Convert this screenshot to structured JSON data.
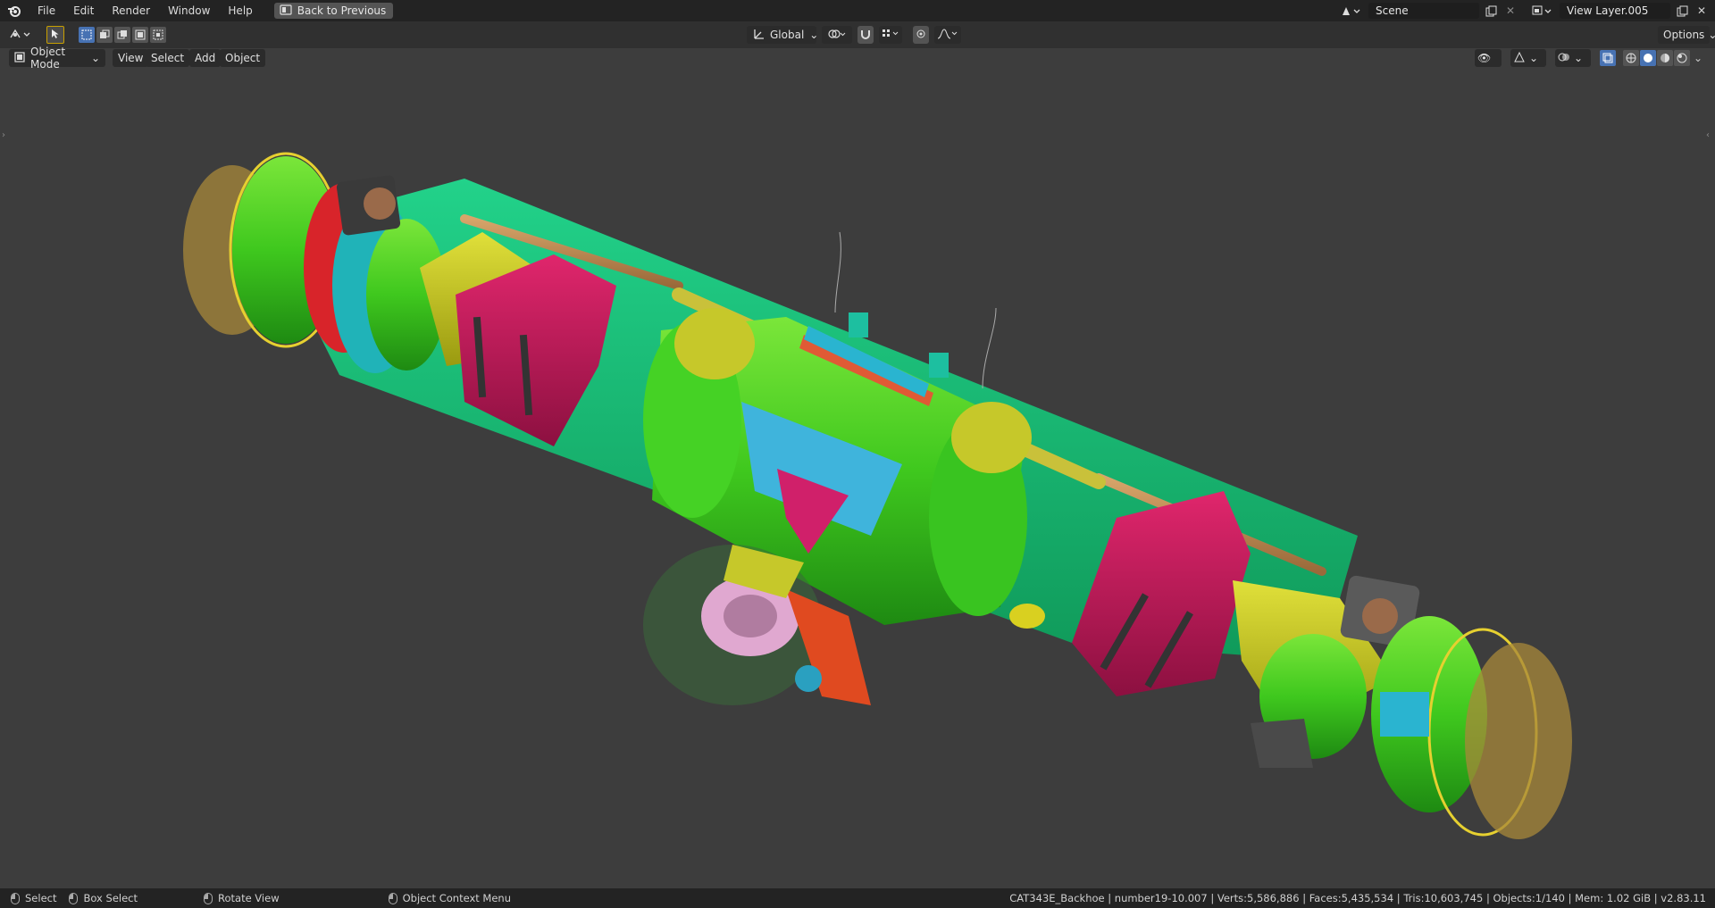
{
  "topbar": {
    "menus": [
      "File",
      "Edit",
      "Render",
      "Window",
      "Help"
    ],
    "back_button": "Back to Previous",
    "scene_name": "Scene",
    "view_layer_name": "View Layer.005"
  },
  "header": {
    "transform_orientation": "Global",
    "options_label": "Options"
  },
  "viewport_header": {
    "mode": "Object Mode",
    "menus": [
      "View",
      "Select",
      "Add",
      "Object"
    ]
  },
  "statusbar": {
    "select": "Select",
    "box_select": "Box Select",
    "rotate_view": "Rotate View",
    "context_menu": "Object Context Menu",
    "stats": "CAT343E_Backhoe | number19-10.007 | Verts:5,586,886 | Faces:5,435,534 | Tris:10,603,745 | Objects:1/140 | Mem: 1.02 GiB | v2.83.11"
  },
  "colors": {
    "topbar_bg": "#232323",
    "header_bg": "#303030",
    "viewport_bg": "#3d3d3d",
    "accent_active": "#4772b3"
  },
  "icons": {
    "app_logo": "blender-logo-icon",
    "back": "back-to-previous-icon",
    "scene": "scene-icon",
    "view_layer": "view-layer-icon",
    "editor_type": "3d-viewport-editor-icon",
    "select_tool": "cursor-select-icon",
    "snap": "magnet-snap-icon",
    "proportional": "proportional-edit-icon",
    "shading": "shading-solid-icon"
  }
}
